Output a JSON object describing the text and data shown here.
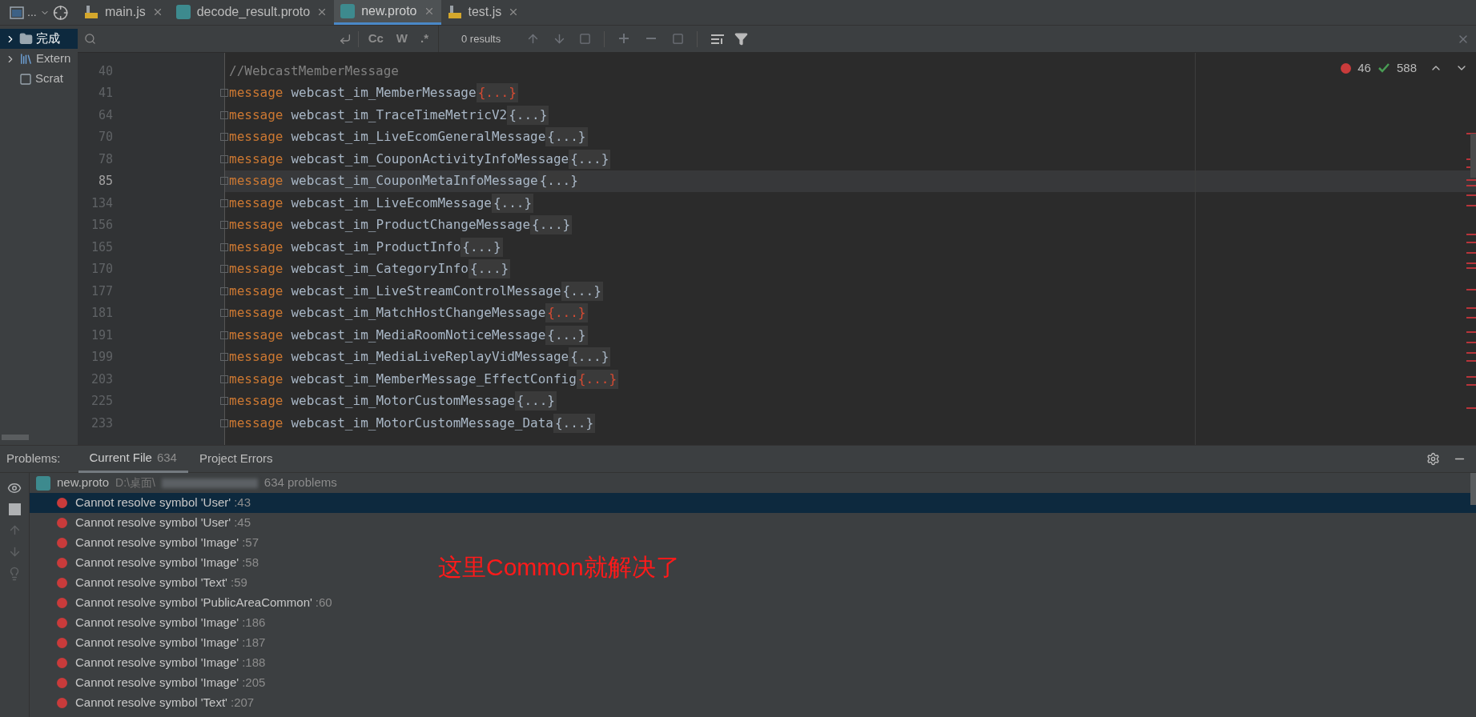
{
  "tool_window_button": {
    "label": "..."
  },
  "tabs": [
    {
      "label": "main.js",
      "kind": "js",
      "selected": false
    },
    {
      "label": "decode_result.proto",
      "kind": "proto",
      "selected": false
    },
    {
      "label": "new.proto",
      "kind": "proto",
      "selected": true
    },
    {
      "label": "test.js",
      "kind": "js",
      "selected": false
    }
  ],
  "sidebar": {
    "items": [
      {
        "label": "完成",
        "kind": "folder",
        "selected": true
      },
      {
        "label": "Extern",
        "kind": "library",
        "selected": false
      },
      {
        "label": "Scrat",
        "kind": "scratch",
        "selected": false
      }
    ]
  },
  "search_bar": {
    "options": [
      "Cc",
      "W",
      ".*"
    ],
    "results": "0 results"
  },
  "editor": {
    "error_count": "46",
    "typo_count": "588",
    "lines": [
      {
        "number": "40",
        "kind": "comment",
        "text": "//WebcastMemberMessage",
        "current": false
      },
      {
        "number": "41",
        "kind": "message",
        "keyword": "message",
        "name": "webcast_im_MemberMessage",
        "fold": "{...}",
        "error": true,
        "current": false
      },
      {
        "number": "64",
        "kind": "message",
        "keyword": "message",
        "name": "webcast_im_TraceTimeMetricV2",
        "fold": "{...}",
        "error": false,
        "current": false
      },
      {
        "number": "70",
        "kind": "message",
        "keyword": "message",
        "name": "webcast_im_LiveEcomGeneralMessage",
        "fold": "{...}",
        "error": false,
        "current": false
      },
      {
        "number": "78",
        "kind": "message",
        "keyword": "message",
        "name": "webcast_im_CouponActivityInfoMessage",
        "fold": "{...}",
        "error": false,
        "current": false
      },
      {
        "number": "85",
        "kind": "message",
        "keyword": "message",
        "name": "webcast_im_CouponMetaInfoMessage",
        "fold": "{...}",
        "error": false,
        "current": true
      },
      {
        "number": "134",
        "kind": "message",
        "keyword": "message",
        "name": "webcast_im_LiveEcomMessage",
        "fold": "{...}",
        "error": false,
        "current": false
      },
      {
        "number": "156",
        "kind": "message",
        "keyword": "message",
        "name": "webcast_im_ProductChangeMessage",
        "fold": "{...}",
        "error": false,
        "current": false
      },
      {
        "number": "165",
        "kind": "message",
        "keyword": "message",
        "name": "webcast_im_ProductInfo",
        "fold": "{...}",
        "error": false,
        "current": false
      },
      {
        "number": "170",
        "kind": "message",
        "keyword": "message",
        "name": "webcast_im_CategoryInfo",
        "fold": "{...}",
        "error": false,
        "current": false
      },
      {
        "number": "177",
        "kind": "message",
        "keyword": "message",
        "name": "webcast_im_LiveStreamControlMessage",
        "fold": "{...}",
        "error": false,
        "current": false
      },
      {
        "number": "181",
        "kind": "message",
        "keyword": "message",
        "name": "webcast_im_MatchHostChangeMessage",
        "fold": "{...}",
        "error": true,
        "current": false
      },
      {
        "number": "191",
        "kind": "message",
        "keyword": "message",
        "name": "webcast_im_MediaRoomNoticeMessage",
        "fold": "{...}",
        "error": false,
        "current": false
      },
      {
        "number": "199",
        "kind": "message",
        "keyword": "message",
        "name": "webcast_im_MediaLiveReplayVidMessage",
        "fold": "{...}",
        "error": false,
        "current": false
      },
      {
        "number": "203",
        "kind": "message",
        "keyword": "message",
        "name": "webcast_im_MemberMessage_EffectConfig",
        "fold": "{...}",
        "error": true,
        "current": false
      },
      {
        "number": "225",
        "kind": "message",
        "keyword": "message",
        "name": "webcast_im_MotorCustomMessage",
        "fold": "{...}",
        "error": false,
        "current": false
      },
      {
        "number": "233",
        "kind": "message",
        "keyword": "message",
        "name": "webcast_im_MotorCustomMessage_Data",
        "fold": "{...}",
        "error": false,
        "current": false
      }
    ]
  },
  "problems": {
    "title": "Problems:",
    "tabs": [
      {
        "label": "Current File",
        "count": "634",
        "selected": true
      },
      {
        "label": "Project Errors",
        "selected": false
      }
    ],
    "file": {
      "name": "new.proto",
      "path": "D:\\桌面\\",
      "summary": "634 problems"
    },
    "items": [
      {
        "message": "Cannot resolve symbol 'User'",
        "line": ":43",
        "selected": true
      },
      {
        "message": "Cannot resolve symbol 'User'",
        "line": ":45",
        "selected": false
      },
      {
        "message": "Cannot resolve symbol 'Image'",
        "line": ":57",
        "selected": false
      },
      {
        "message": "Cannot resolve symbol 'Image'",
        "line": ":58",
        "selected": false
      },
      {
        "message": "Cannot resolve symbol 'Text'",
        "line": ":59",
        "selected": false
      },
      {
        "message": "Cannot resolve symbol 'PublicAreaCommon'",
        "line": ":60",
        "selected": false
      },
      {
        "message": "Cannot resolve symbol 'Image'",
        "line": ":186",
        "selected": false
      },
      {
        "message": "Cannot resolve symbol 'Image'",
        "line": ":187",
        "selected": false
      },
      {
        "message": "Cannot resolve symbol 'Image'",
        "line": ":188",
        "selected": false
      },
      {
        "message": "Cannot resolve symbol 'Image'",
        "line": ":205",
        "selected": false
      },
      {
        "message": "Cannot resolve symbol 'Text'",
        "line": ":207",
        "selected": false
      }
    ]
  },
  "annotation": "这里Common就解决了"
}
